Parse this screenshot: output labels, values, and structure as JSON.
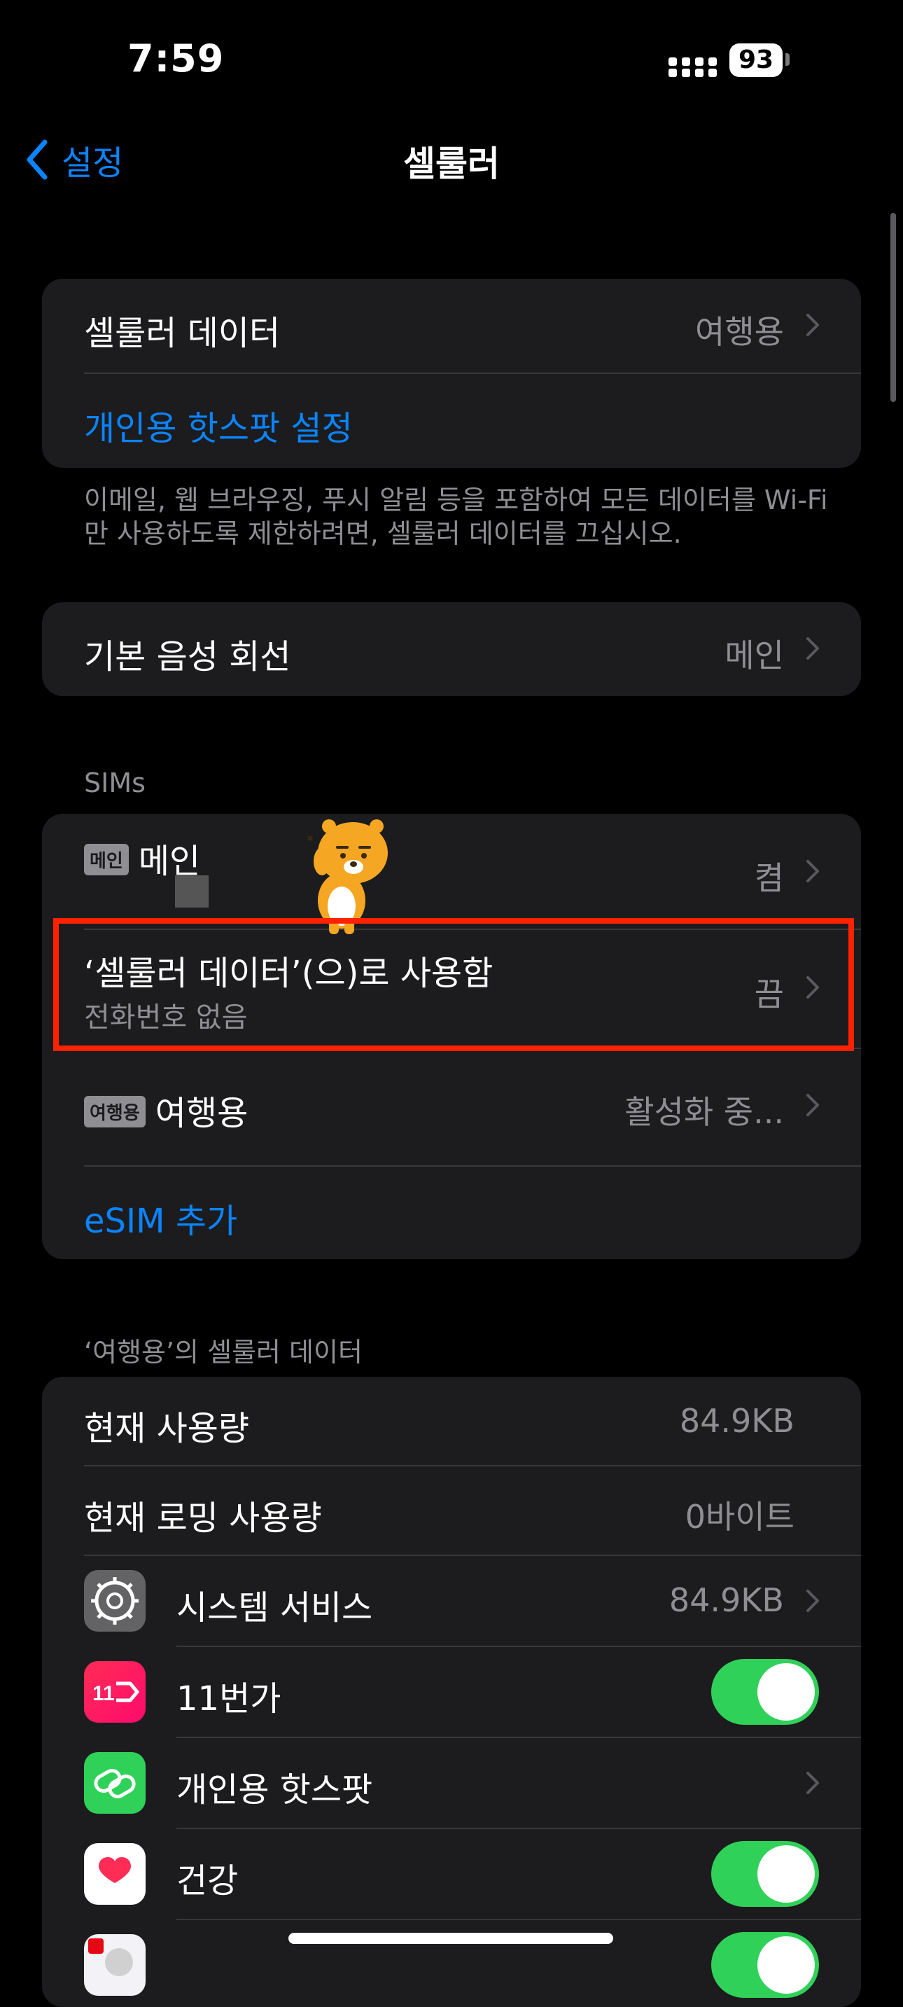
{
  "status": {
    "time": "7:59",
    "battery": "93"
  },
  "nav": {
    "back_label": "설정",
    "title": "셀룰러"
  },
  "group1": {
    "cellular_data_label": "셀룰러 데이터",
    "cellular_data_value": "여행용",
    "hotspot_label": "개인용 핫스팟 설정"
  },
  "footer1": "이메일, 웹 브라우징, 푸시 알림 등을 포함하여 모든 데이터를 Wi-Fi 만 사용하도록 제한하려면, 셀룰러 데이터를 끄십시오.",
  "group2": {
    "voice_label": "기본 음성 회선",
    "voice_value": "메인"
  },
  "sims": {
    "header": "SIMs",
    "main_badge": "메인",
    "main_label": "메인",
    "main_value": "켬",
    "use_label": "‘셀룰러 데이터’(으)로 사용함",
    "use_sub": "전화번호 없음",
    "use_value": "끔",
    "travel_badge": "여행용",
    "travel_label": "여행용",
    "travel_value": "활성화 중...",
    "esim_label": "eSIM 추가"
  },
  "usage": {
    "header": "‘여행용’의 셀룰러 데이터",
    "current_label": "현재 사용량",
    "current_value": "84.9KB",
    "roaming_label": "현재 로밍 사용량",
    "roaming_value": "0바이트",
    "apps": [
      {
        "name": "시스템 서비스",
        "value": "84.9KB",
        "icon": "gear-icon",
        "control": "chevron"
      },
      {
        "name": "11번가",
        "value": "",
        "icon": "11st-app-icon",
        "control": "toggle-on"
      },
      {
        "name": "개인용 핫스팟",
        "value": "",
        "icon": "hotspot-icon",
        "control": "chevron"
      },
      {
        "name": "건강",
        "value": "",
        "icon": "health-heart-icon",
        "control": "toggle-on"
      }
    ]
  },
  "colors": {
    "accent": "#0a84ff",
    "toggle_on": "#30d158",
    "highlight_box": "#ff2200",
    "cell_bg": "#1c1c1e"
  }
}
